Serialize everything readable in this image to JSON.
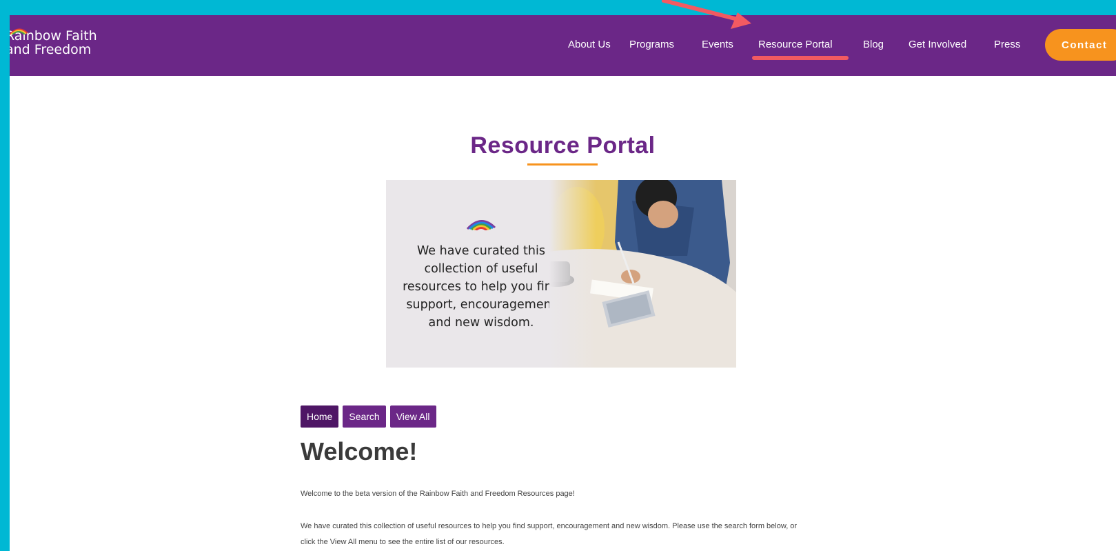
{
  "brand": {
    "line1": "Rainbow Faith",
    "line2": "and Freedom"
  },
  "nav": {
    "items": [
      "About Us",
      "Programs",
      "Events",
      "Resource Portal",
      "Blog",
      "Get Involved",
      "Press"
    ],
    "active": "Resource Portal",
    "contact_label": "Contact"
  },
  "colors": {
    "brand_purple": "#6b2787",
    "accent_orange": "#f7931e",
    "annotation_red": "#f25a61",
    "outer_cyan": "#00b8d4"
  },
  "page": {
    "title": "Resource Portal",
    "hero_text": "We have curated this collection of useful resources to help you find support, encouragement and new wisdom."
  },
  "subnav": {
    "home": "Home",
    "search": "Search",
    "view_all": "View All"
  },
  "content": {
    "heading": "Welcome!",
    "para1": "Welcome to the beta version of the Rainbow Faith and Freedom Resources page!",
    "para2": "We have curated this collection of useful resources to help you find support, encouragement and new wisdom. Please use the search form below, or click the View All menu to see the entire list of our resources."
  },
  "icons": {
    "logo": "rainbow-icon",
    "annotation": "arrow-icon"
  }
}
